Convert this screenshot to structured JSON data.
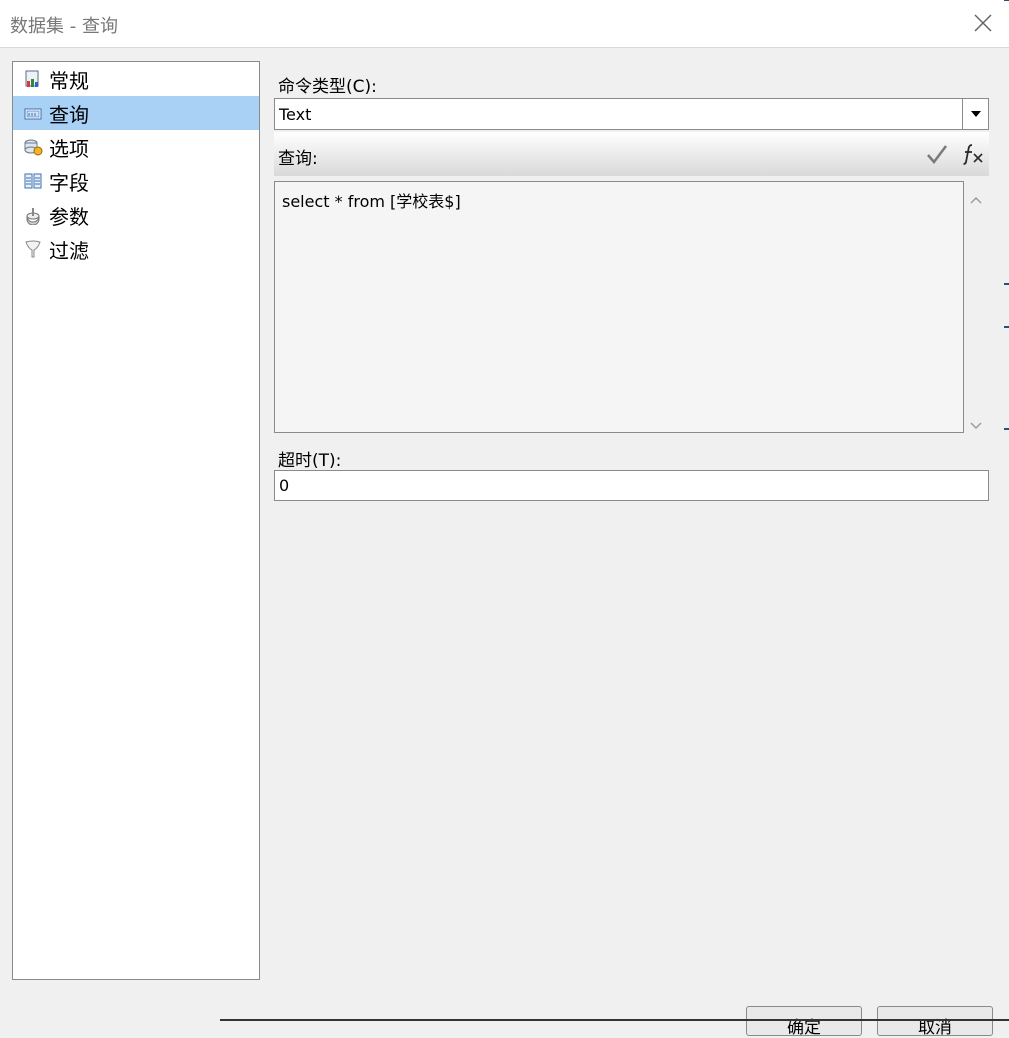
{
  "window": {
    "title": "数据集 - 查询"
  },
  "nav": {
    "items": [
      {
        "label": "常规",
        "icon": "general-icon"
      },
      {
        "label": "查询",
        "icon": "query-icon",
        "selected": true
      },
      {
        "label": "选项",
        "icon": "options-icon"
      },
      {
        "label": "字段",
        "icon": "fields-icon"
      },
      {
        "label": "参数",
        "icon": "parameters-icon"
      },
      {
        "label": "过滤",
        "icon": "filter-icon"
      }
    ]
  },
  "command_type": {
    "label": "命令类型(C):",
    "value": "Text"
  },
  "query": {
    "label": "查询:",
    "text": "select * from [学校表$]"
  },
  "timeout": {
    "label": "超时(T):",
    "value": "0"
  },
  "buttons": {
    "ok": "确定",
    "cancel": "取消"
  },
  "colors": {
    "selection": "#a9d0f5",
    "accent_edge": "#2d4f73"
  }
}
